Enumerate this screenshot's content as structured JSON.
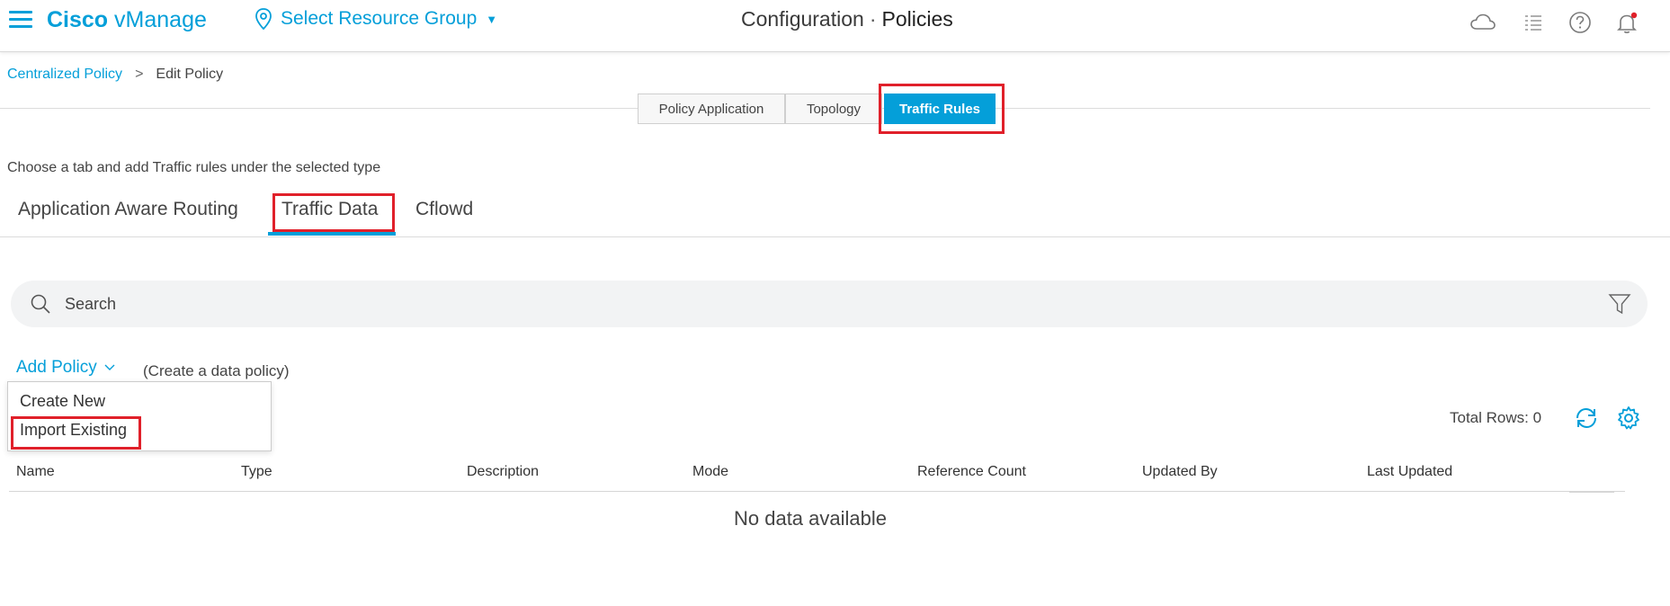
{
  "header": {
    "brand_bold": "Cisco",
    "brand_rest": "vManage",
    "resource_group": "Select Resource Group",
    "title_section": "Configuration",
    "title_sep": "·",
    "title_page": "Policies",
    "icons": [
      "cloud-icon",
      "list-icon",
      "help-icon",
      "notification-bell-icon"
    ]
  },
  "breadcrumb": {
    "link": "Centralized Policy",
    "separator": ">",
    "current": "Edit Policy"
  },
  "top_tabs": [
    {
      "label": "Policy Application",
      "active": false
    },
    {
      "label": "Topology",
      "active": false
    },
    {
      "label": "Traffic Rules",
      "active": true
    }
  ],
  "instruction": "Choose a tab and add Traffic rules under the selected type",
  "sub_tabs": [
    {
      "label": "Application Aware Routing",
      "active": false
    },
    {
      "label": "Traffic Data",
      "active": true
    },
    {
      "label": "Cflowd",
      "active": false
    }
  ],
  "search": {
    "placeholder": "Search"
  },
  "add_policy": {
    "label": "Add Policy",
    "hint": "(Create a data policy)",
    "menu": [
      "Create New",
      "Import Existing"
    ]
  },
  "table": {
    "total_rows": "Total Rows: 0",
    "columns": [
      "Name",
      "Type",
      "Description",
      "Mode",
      "Reference Count",
      "Updated By",
      "Last Updated"
    ],
    "empty_text": "No data available"
  },
  "colors": {
    "accent": "#049fd9",
    "highlight_box": "#e0202a"
  }
}
